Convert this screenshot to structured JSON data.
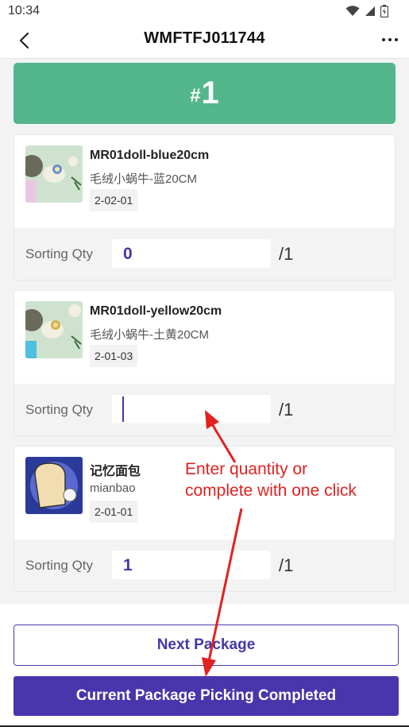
{
  "status_bar": {
    "time": "10:34",
    "icons": [
      "wifi-icon",
      "signal-icon",
      "battery-icon"
    ]
  },
  "header": {
    "title": "WMFTFJ011744",
    "back_icon": "chevron-left-icon",
    "more_icon": "more-horizontal-icon"
  },
  "package": {
    "hash": "#",
    "number": "1",
    "color": "#53b68c"
  },
  "items": [
    {
      "sku": "MR01doll-blue20cm",
      "name": "毛绒小蜗牛-蓝20CM",
      "location": "2-02-01",
      "qty_label": "Sorting Qty",
      "qty_value": "0",
      "qty_total": "/1"
    },
    {
      "sku": "MR01doll-yellow20cm",
      "name": "毛绒小蜗牛-土黄20CM",
      "location": "2-01-03",
      "qty_label": "Sorting Qty",
      "qty_value": "",
      "qty_total": "/1"
    },
    {
      "sku": "记忆面包",
      "name": "mianbao",
      "location": "2-01-01",
      "qty_label": "Sorting Qty",
      "qty_value": "1",
      "qty_total": "/1"
    }
  ],
  "annotation": {
    "line1": "Enter quantity or",
    "line2": "complete with one click",
    "color": "#e02222"
  },
  "actions": {
    "next_package": "Next Package",
    "complete": "Current Package Picking Completed",
    "accent": "#4936ac"
  }
}
